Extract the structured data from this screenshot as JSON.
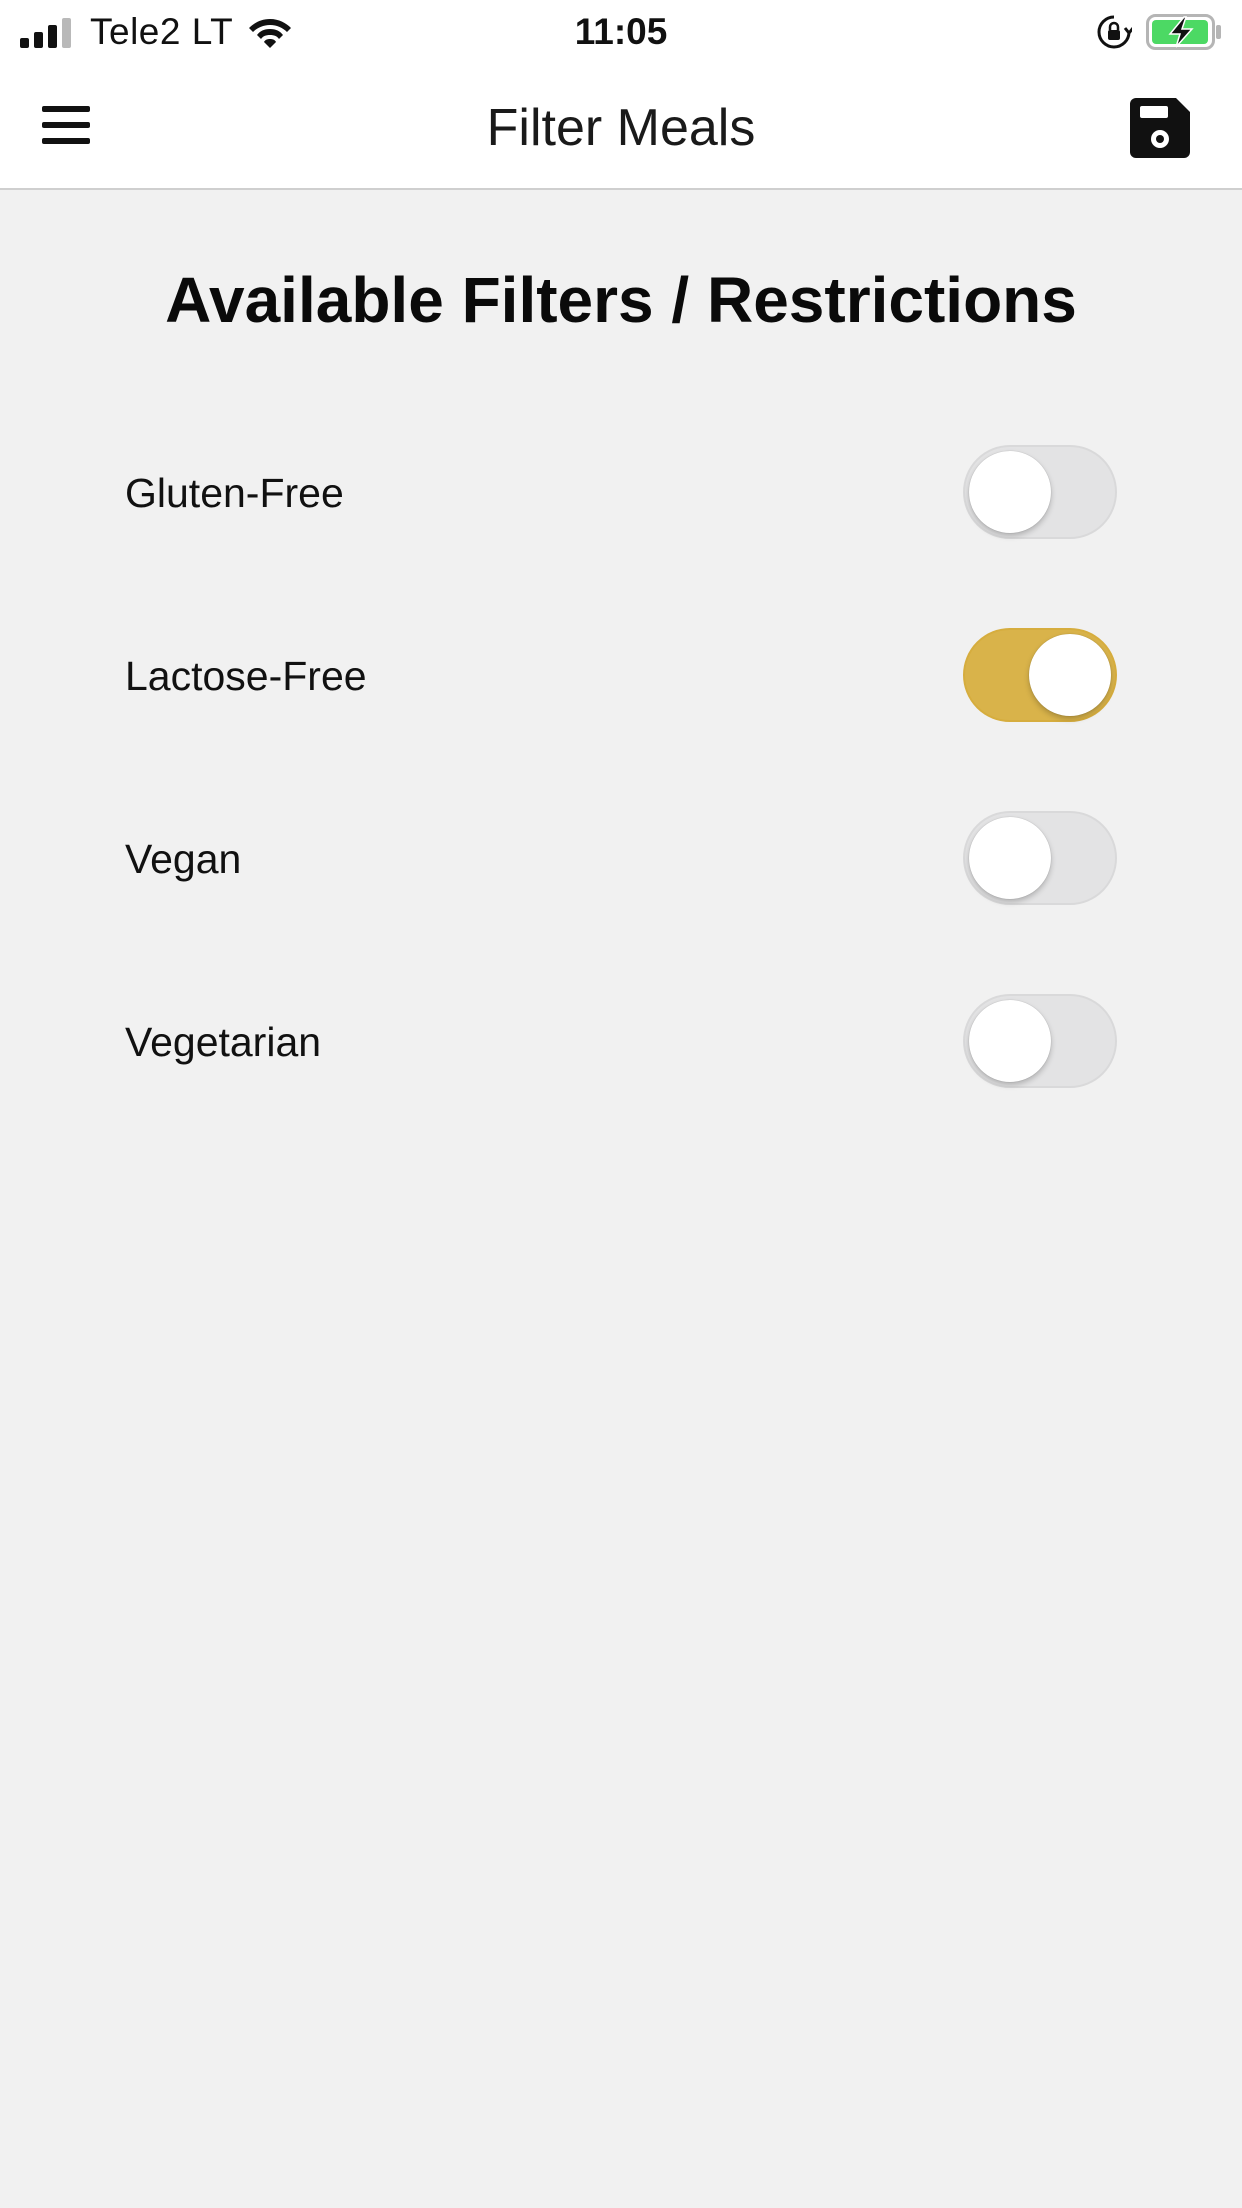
{
  "status_bar": {
    "carrier": "Tele2 LT",
    "time": "11:05",
    "signal_bars": 3,
    "signal_bars_total": 4,
    "icons": [
      "signal-icon",
      "wifi-icon",
      "orientation-lock-icon",
      "battery-charging-icon"
    ],
    "battery_color": "#4cd964"
  },
  "header": {
    "title": "Filter Meals",
    "menu_icon": "hamburger-menu-icon",
    "save_icon": "floppy-disk-save-icon"
  },
  "content": {
    "title": "Available Filters / Restrictions",
    "filters": [
      {
        "label": "Gluten-Free",
        "enabled": false
      },
      {
        "label": "Lactose-Free",
        "enabled": true
      },
      {
        "label": "Vegan",
        "enabled": false
      },
      {
        "label": "Vegetarian",
        "enabled": false
      }
    ]
  },
  "colors": {
    "accent": "#d9b34a",
    "switch_off": "#e3e3e4",
    "background": "#f1f1f1",
    "header_background": "#ffffff"
  }
}
